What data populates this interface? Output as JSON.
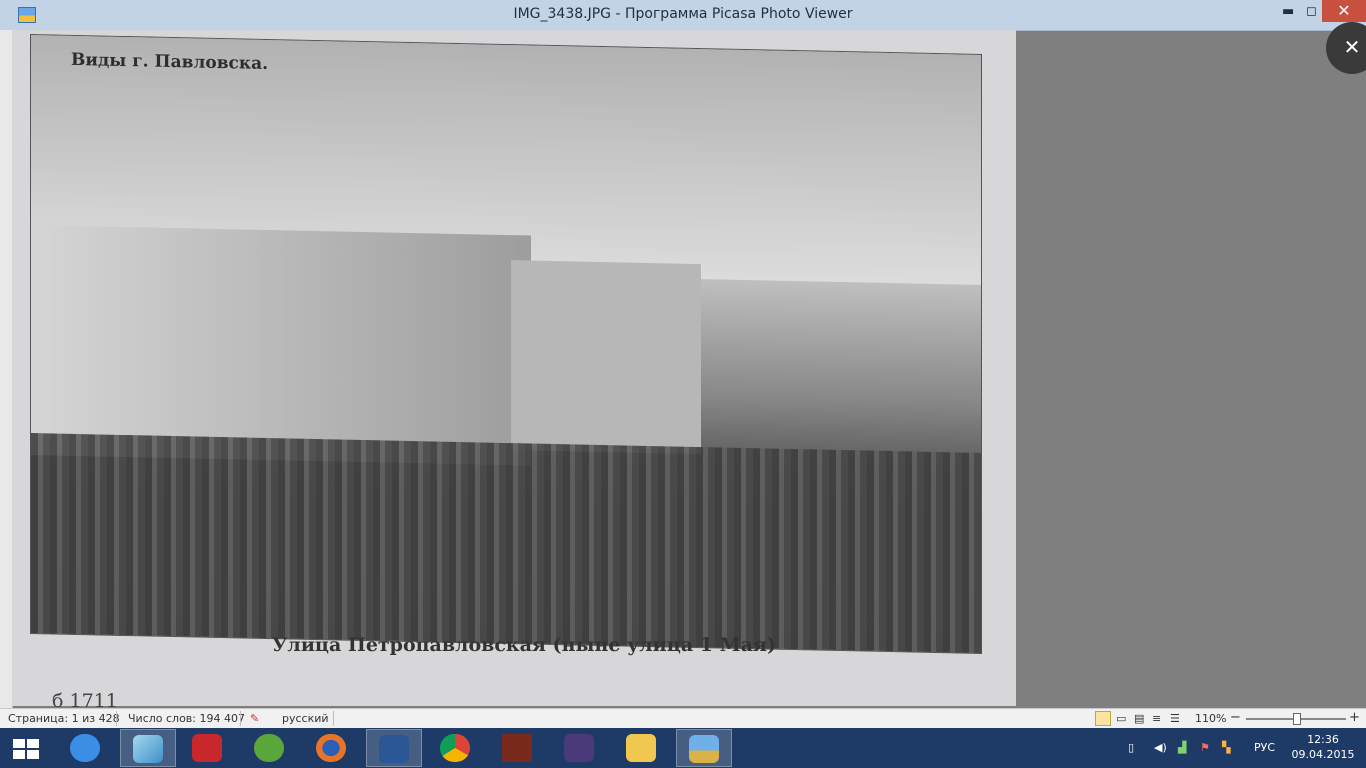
{
  "window": {
    "title": "IMG_3438.JPG - Программа Picasa Photo Viewer",
    "minimize": "▬",
    "maximize": "◻",
    "close": "✕"
  },
  "viewer": {
    "close_overlay": "✕"
  },
  "photo": {
    "header_text": "Виды г. Павловска.",
    "caption": "Улица Петропавловская (ныне  улица 1 Мая)",
    "fragment": "б   1711"
  },
  "statusbar": {
    "page": "Страница: 1 из 428",
    "words": "Число слов: 194 407",
    "language": "русский",
    "zoom": "110%",
    "zoom_level_percent": 110,
    "zoom_minus": "−",
    "zoom_plus": "+"
  },
  "taskbar": {
    "apps": [
      "start-icon",
      "internet-explorer-icon",
      "picasa-icon",
      "acrobat-icon",
      "utorrent-icon",
      "firefox-icon",
      "word-icon",
      "chrome-icon",
      "quake-icon",
      "game-shield-icon",
      "file-explorer-icon",
      "photo-viewer-icon"
    ],
    "lang": "РУС",
    "time": "12:36",
    "date": "09.04.2015"
  }
}
